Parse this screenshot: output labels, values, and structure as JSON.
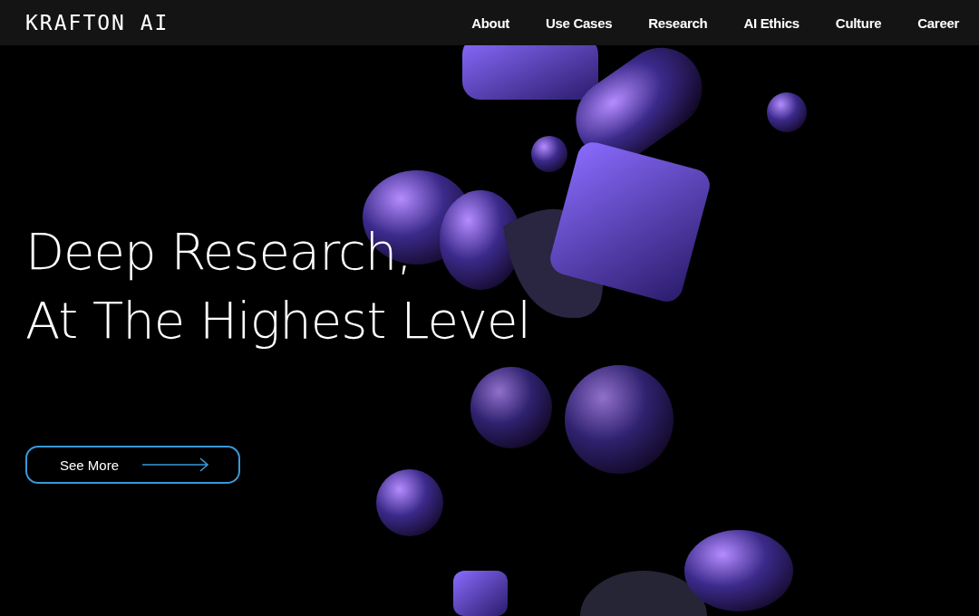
{
  "header": {
    "logo": "KRAFTON AI",
    "nav": [
      {
        "label": "About"
      },
      {
        "label": "Use Cases"
      },
      {
        "label": "Research"
      },
      {
        "label": "AI Ethics"
      },
      {
        "label": "Culture"
      },
      {
        "label": "Career"
      }
    ]
  },
  "hero": {
    "headline": [
      "Deep Research,",
      "At The Highest Level"
    ],
    "button": "See More"
  }
}
